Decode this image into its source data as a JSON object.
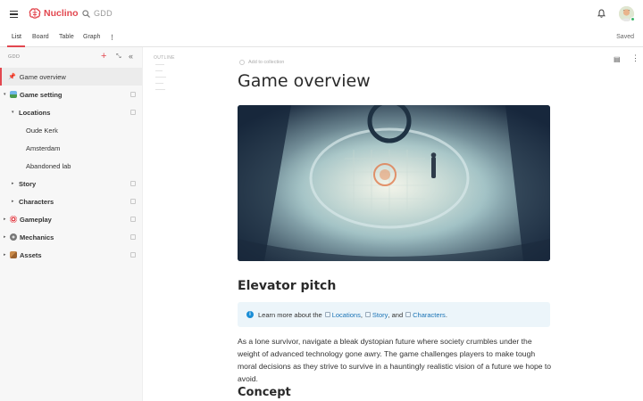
{
  "app": {
    "name": "Nuclino",
    "search_text": "GDD",
    "status": "Saved",
    "brand_color": "#e2474f"
  },
  "tabs": [
    {
      "label": "List",
      "active": true
    },
    {
      "label": "Board",
      "active": false
    },
    {
      "label": "Table",
      "active": false
    },
    {
      "label": "Graph",
      "active": false
    }
  ],
  "sidebar": {
    "header": "GDD",
    "items": [
      {
        "label": "Game overview",
        "icon": "pin-icon",
        "active": true
      },
      {
        "label": "Game setting",
        "icon": "landscape-icon"
      },
      {
        "label": "Locations"
      },
      {
        "label": "Oude Kerk"
      },
      {
        "label": "Amsterdam"
      },
      {
        "label": "Abandoned lab"
      },
      {
        "label": "Story"
      },
      {
        "label": "Characters"
      },
      {
        "label": "Gameplay",
        "icon": "target-icon"
      },
      {
        "label": "Mechanics",
        "icon": "gear-icon"
      },
      {
        "label": "Assets",
        "icon": "box-icon"
      }
    ]
  },
  "outline": {
    "label": "OUTLINE"
  },
  "doc": {
    "add_to_collection": "Add to collection",
    "title": "Game overview",
    "h_pitch": "Elevator pitch",
    "callout": {
      "prefix": "Learn more about the",
      "link1": "Locations",
      "sep1": ",",
      "link2": "Story",
      "sep2": ", and",
      "link3": "Characters",
      "suffix": "."
    },
    "paragraph": "As a lone survivor, navigate a bleak dystopian future where society crumbles under the weight of advanced technology gone awry. The game challenges players to make tough moral decisions as they strive to survive in a hauntingly realistic vision of a future we hope to avoid.",
    "h_concept": "Concept"
  }
}
